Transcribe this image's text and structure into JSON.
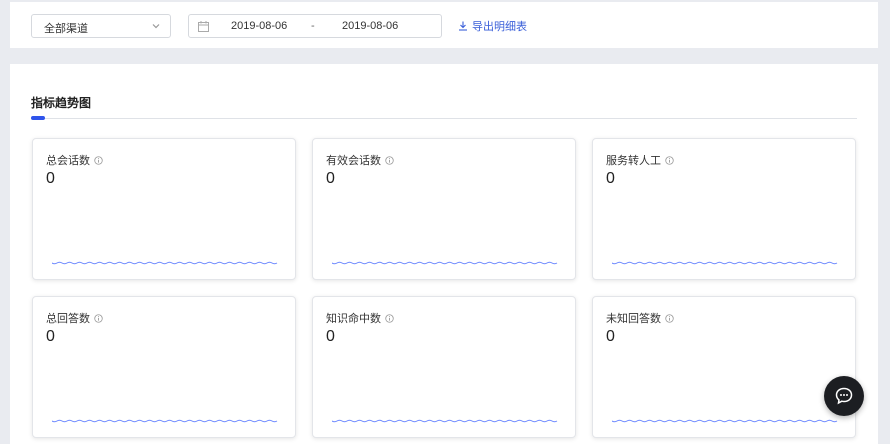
{
  "filters": {
    "channel_select": {
      "value": "全部渠道",
      "icon": "chevron-down-icon"
    },
    "date_range": {
      "icon": "calendar-icon",
      "start": "2019-08-06",
      "separator": "-",
      "end": "2019-08-06"
    },
    "export_link": {
      "label": "导出明细表",
      "icon": "download-icon"
    }
  },
  "section": {
    "title": "指标趋势图",
    "accent_color": "#2f54eb"
  },
  "metrics": [
    {
      "label": "总会话数",
      "value": "0",
      "icon": "info-icon"
    },
    {
      "label": "有效会话数",
      "value": "0",
      "icon": "info-icon"
    },
    {
      "label": "服务转人工",
      "value": "0",
      "icon": "info-icon"
    },
    {
      "label": "总回答数",
      "value": "0",
      "icon": "info-icon"
    },
    {
      "label": "知识命中数",
      "value": "0",
      "icon": "info-icon"
    },
    {
      "label": "未知回答数",
      "value": "0",
      "icon": "info-icon"
    }
  ],
  "sparkline_color": "#6a86ff",
  "chat_button": {
    "icon": "chat-icon"
  }
}
